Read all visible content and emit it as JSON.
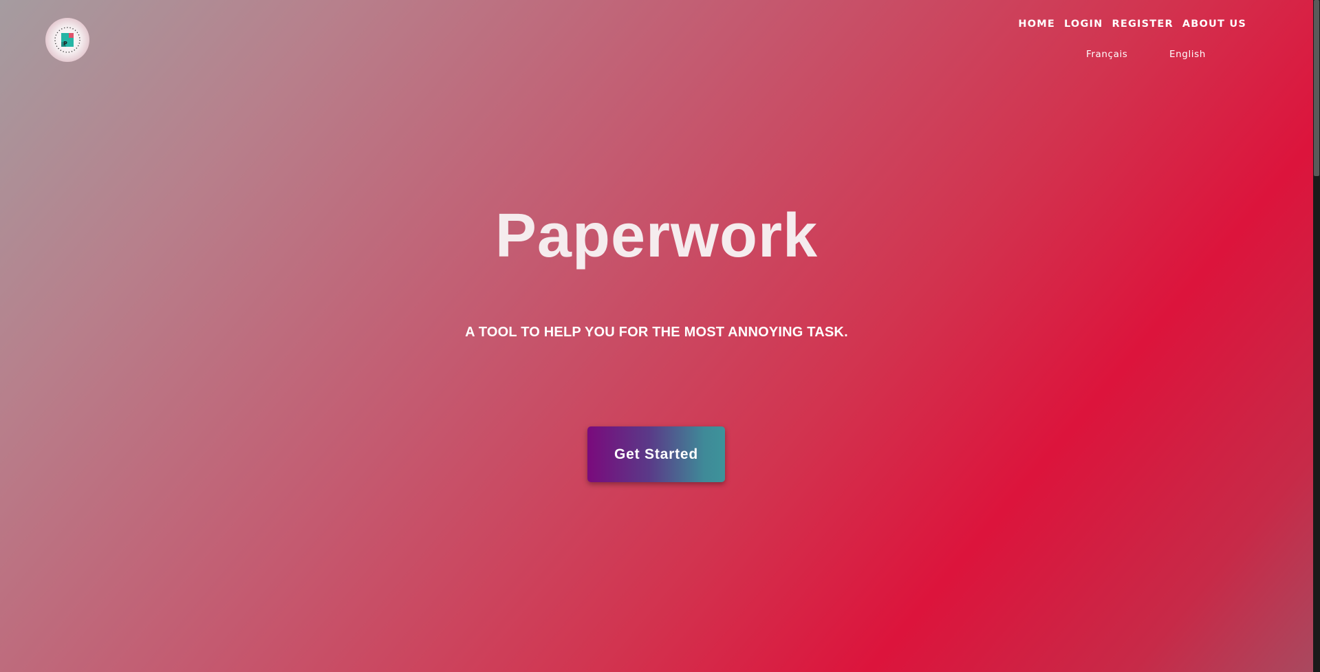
{
  "header": {
    "logo": {
      "icon": "paperwork-logo-icon",
      "letter": "P"
    },
    "nav": [
      {
        "label": "HOME"
      },
      {
        "label": "LOGIN"
      },
      {
        "label": "REGISTER"
      },
      {
        "label": "ABOUT US"
      }
    ],
    "languages": [
      {
        "label": "Français"
      },
      {
        "label": "English"
      }
    ]
  },
  "hero": {
    "title": "Paperwork",
    "subtitle": "A TOOL TO HELP YOU FOR THE MOST ANNOYING TASK.",
    "cta_label": "Get Started"
  },
  "colors": {
    "accent_red": "#dc143c",
    "button_start": "#7a0a7c",
    "button_end": "#3e939a",
    "text": "#ffffff"
  }
}
